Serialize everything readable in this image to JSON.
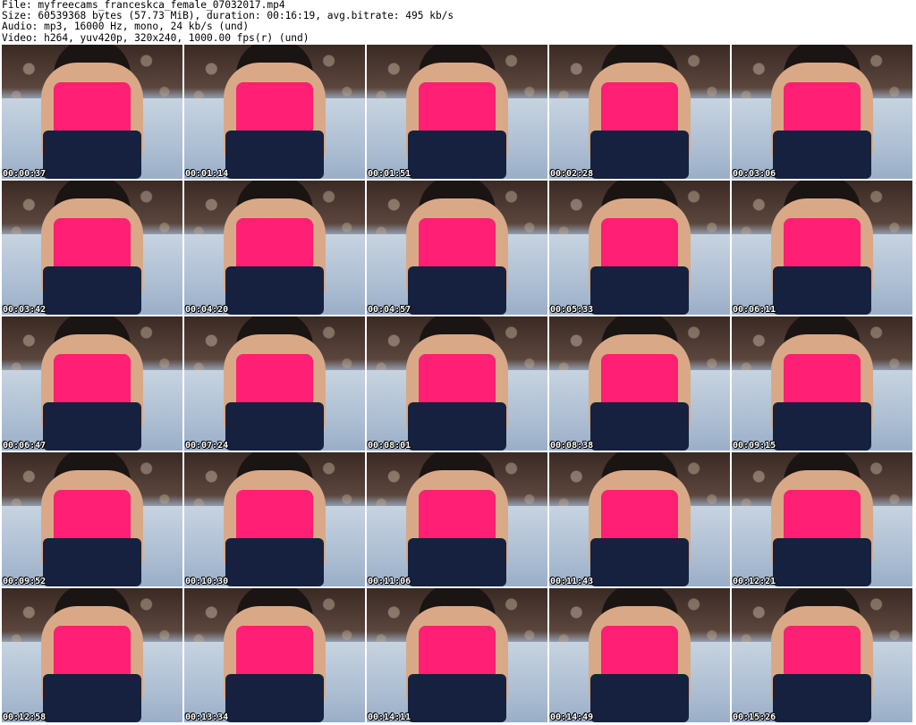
{
  "header": {
    "line1": "File: myfreecams_franceskca_female_07032017.mp4",
    "line2": "Size: 60539368 bytes (57.73 MiB), duration: 00:16:19, avg.bitrate: 495 kb/s",
    "line3": "Audio: mp3, 16000 Hz, mono, 24 kb/s (und)",
    "line4": "Video: h264, yuv420p, 320x240, 1000.00 fps(r) (und)"
  },
  "timestamps": [
    "00:00:37",
    "00:01:14",
    "00:01:51",
    "00:02:28",
    "00:03:06",
    "00:03:42",
    "00:04:20",
    "00:04:57",
    "00:05:33",
    "00:06:11",
    "00:06:47",
    "00:07:24",
    "00:08:01",
    "00:08:38",
    "00:09:15",
    "00:09:52",
    "00:10:30",
    "00:11:06",
    "00:11:43",
    "00:12:21",
    "00:12:58",
    "00:13:34",
    "00:14:11",
    "00:14:49",
    "00:15:26"
  ]
}
